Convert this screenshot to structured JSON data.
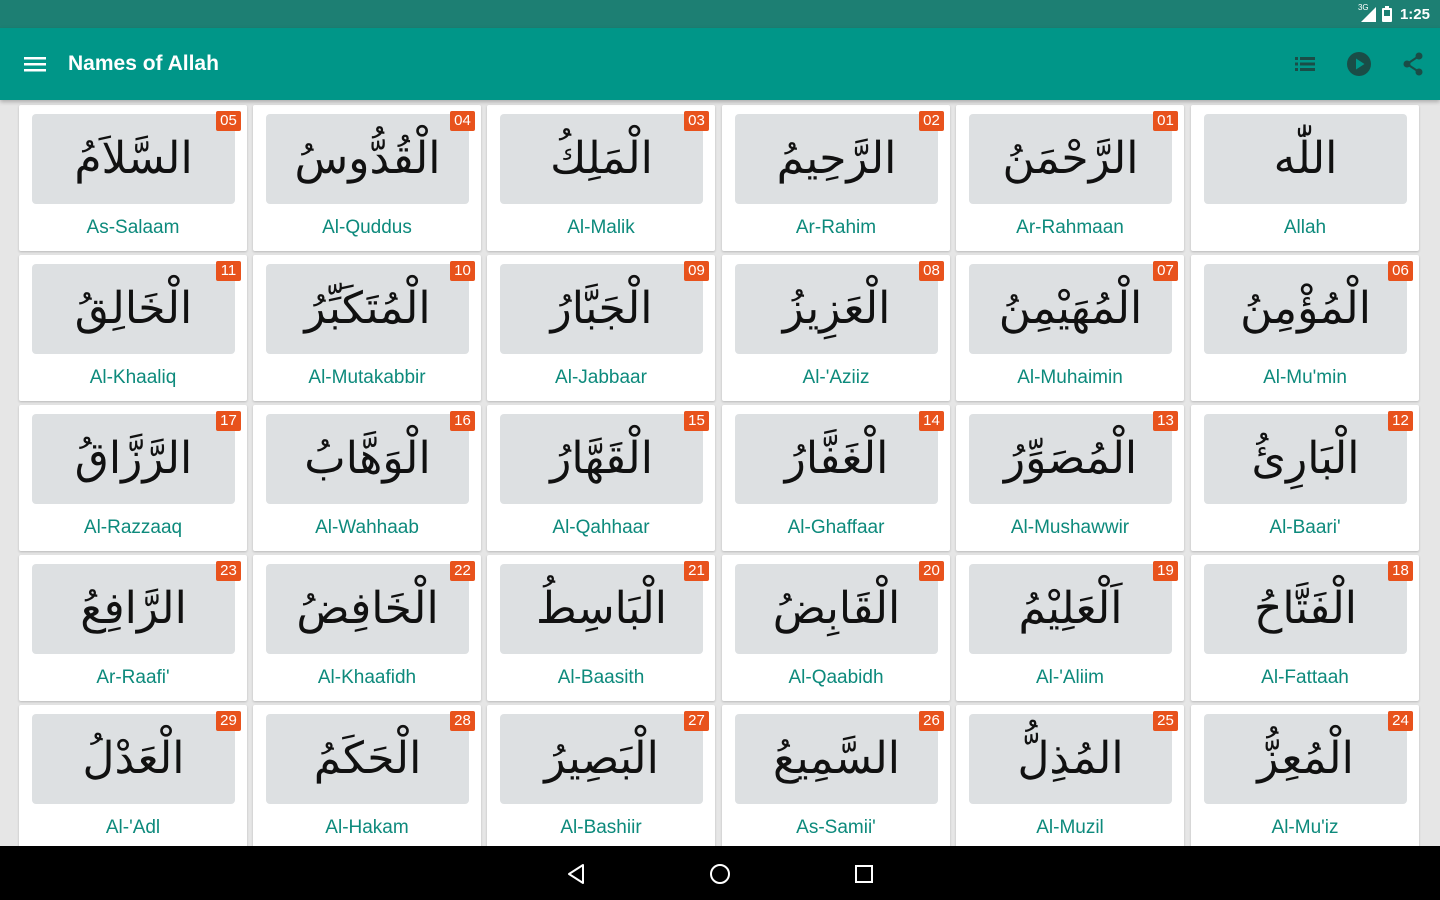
{
  "status_bar": {
    "time": "1:25",
    "network": "3G",
    "icons": [
      "signal-icon",
      "battery-icon"
    ]
  },
  "app_bar": {
    "title": "Names of Allah",
    "icons": [
      "menu-icon",
      "list-icon",
      "play-icon",
      "share-icon"
    ],
    "color": "#009688"
  },
  "colors": {
    "badge": "#e8521c",
    "translit": "#0d8a7c",
    "arabic_bg": "#dde0e2"
  },
  "names": [
    {
      "number": "",
      "arabic": "اللّٰه",
      "translit": "Allah"
    },
    {
      "number": "01",
      "arabic": "الرَّحْمَنُ",
      "translit": "Ar-Rahmaan"
    },
    {
      "number": "02",
      "arabic": "الرَّحِيمُ",
      "translit": "Ar-Rahim"
    },
    {
      "number": "03",
      "arabic": "الْمَلِكُ",
      "translit": "Al-Malik"
    },
    {
      "number": "04",
      "arabic": "الْقُدُّوسُ",
      "translit": "Al-Quddus"
    },
    {
      "number": "05",
      "arabic": "السَّلاَمُ",
      "translit": "As-Salaam"
    },
    {
      "number": "06",
      "arabic": "الْمُؤْمِنُ",
      "translit": "Al-Mu'min"
    },
    {
      "number": "07",
      "arabic": "الْمُهَيْمِنُ",
      "translit": "Al-Muhaimin"
    },
    {
      "number": "08",
      "arabic": "الْعَزِيزُ",
      "translit": "Al-'Aziiz"
    },
    {
      "number": "09",
      "arabic": "الْجَبَّارُ",
      "translit": "Al-Jabbaar"
    },
    {
      "number": "10",
      "arabic": "الْمُتَكَبِّرُ",
      "translit": "Al-Mutakabbir"
    },
    {
      "number": "11",
      "arabic": "الْخَالِقُ",
      "translit": "Al-Khaaliq"
    },
    {
      "number": "12",
      "arabic": "الْبَارِئُ",
      "translit": "Al-Baari'"
    },
    {
      "number": "13",
      "arabic": "الْمُصَوِّرُ",
      "translit": "Al-Mushawwir"
    },
    {
      "number": "14",
      "arabic": "الْغَفَّارُ",
      "translit": "Al-Ghaffaar"
    },
    {
      "number": "15",
      "arabic": "الْقَهَّارُ",
      "translit": "Al-Qahhaar"
    },
    {
      "number": "16",
      "arabic": "الْوَهَّابُ",
      "translit": "Al-Wahhaab"
    },
    {
      "number": "17",
      "arabic": "الرَّزَّاقُ",
      "translit": "Al-Razzaaq"
    },
    {
      "number": "18",
      "arabic": "الْفَتَّاحُ",
      "translit": "Al-Fattaah"
    },
    {
      "number": "19",
      "arabic": "اَلْعَلِيْمُ",
      "translit": "Al-'Aliim"
    },
    {
      "number": "20",
      "arabic": "الْقَابِضُ",
      "translit": "Al-Qaabidh"
    },
    {
      "number": "21",
      "arabic": "الْبَاسِطُ",
      "translit": "Al-Baasith"
    },
    {
      "number": "22",
      "arabic": "الْخَافِضُ",
      "translit": "Al-Khaafidh"
    },
    {
      "number": "23",
      "arabic": "الرَّافِعُ",
      "translit": "Ar-Raafi'"
    },
    {
      "number": "24",
      "arabic": "الْمُعِزُّ",
      "translit": "Al-Mu'iz"
    },
    {
      "number": "25",
      "arabic": "المُذِلُّ",
      "translit": "Al-Muzil"
    },
    {
      "number": "26",
      "arabic": "السَّمِيعُ",
      "translit": "As-Samii'"
    },
    {
      "number": "27",
      "arabic": "الْبَصِيرُ",
      "translit": "Al-Bashiir"
    },
    {
      "number": "28",
      "arabic": "الْحَكَمُ",
      "translit": "Al-Hakam"
    },
    {
      "number": "29",
      "arabic": "الْعَدْلُ",
      "translit": "Al-'Adl"
    }
  ],
  "nav_bar": {
    "icons": [
      "back-icon",
      "home-icon",
      "recents-icon"
    ]
  }
}
